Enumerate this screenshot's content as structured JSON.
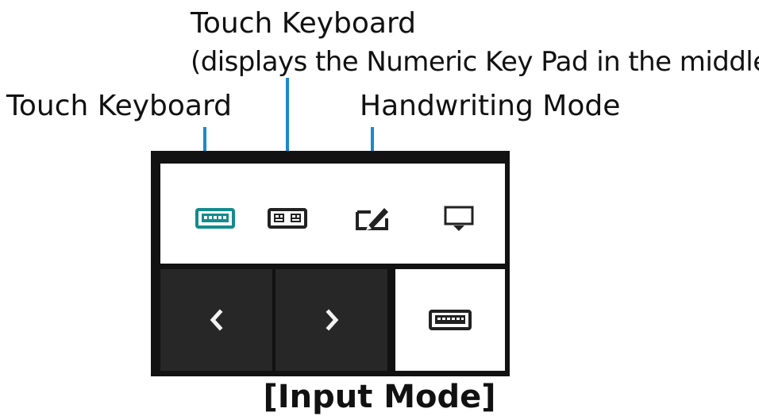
{
  "annotations": {
    "touch_keyboard_numeric_title": "Touch Keyboard",
    "touch_keyboard_numeric_desc": "(displays the Numeric Key Pad in the middle.)",
    "touch_keyboard": "Touch Keyboard",
    "handwriting_mode": "Handwriting Mode"
  },
  "toolbar": {
    "modes": [
      {
        "icon": "keyboard-icon",
        "selected": true
      },
      {
        "icon": "split-keyboard-icon",
        "selected": false
      },
      {
        "icon": "handwriting-pen-icon",
        "selected": false
      },
      {
        "icon": "dock-keyboard-icon",
        "selected": false
      }
    ],
    "nav": [
      {
        "icon": "chevron-left-icon"
      },
      {
        "icon": "chevron-right-icon"
      },
      {
        "icon": "keyboard-icon",
        "selected": true
      }
    ]
  },
  "caption": "[Input Mode]",
  "colors": {
    "accent": "#1b8ac8",
    "selected_icon": "#148c8c",
    "panel_dark": "#121212",
    "button_dark": "#272727"
  }
}
